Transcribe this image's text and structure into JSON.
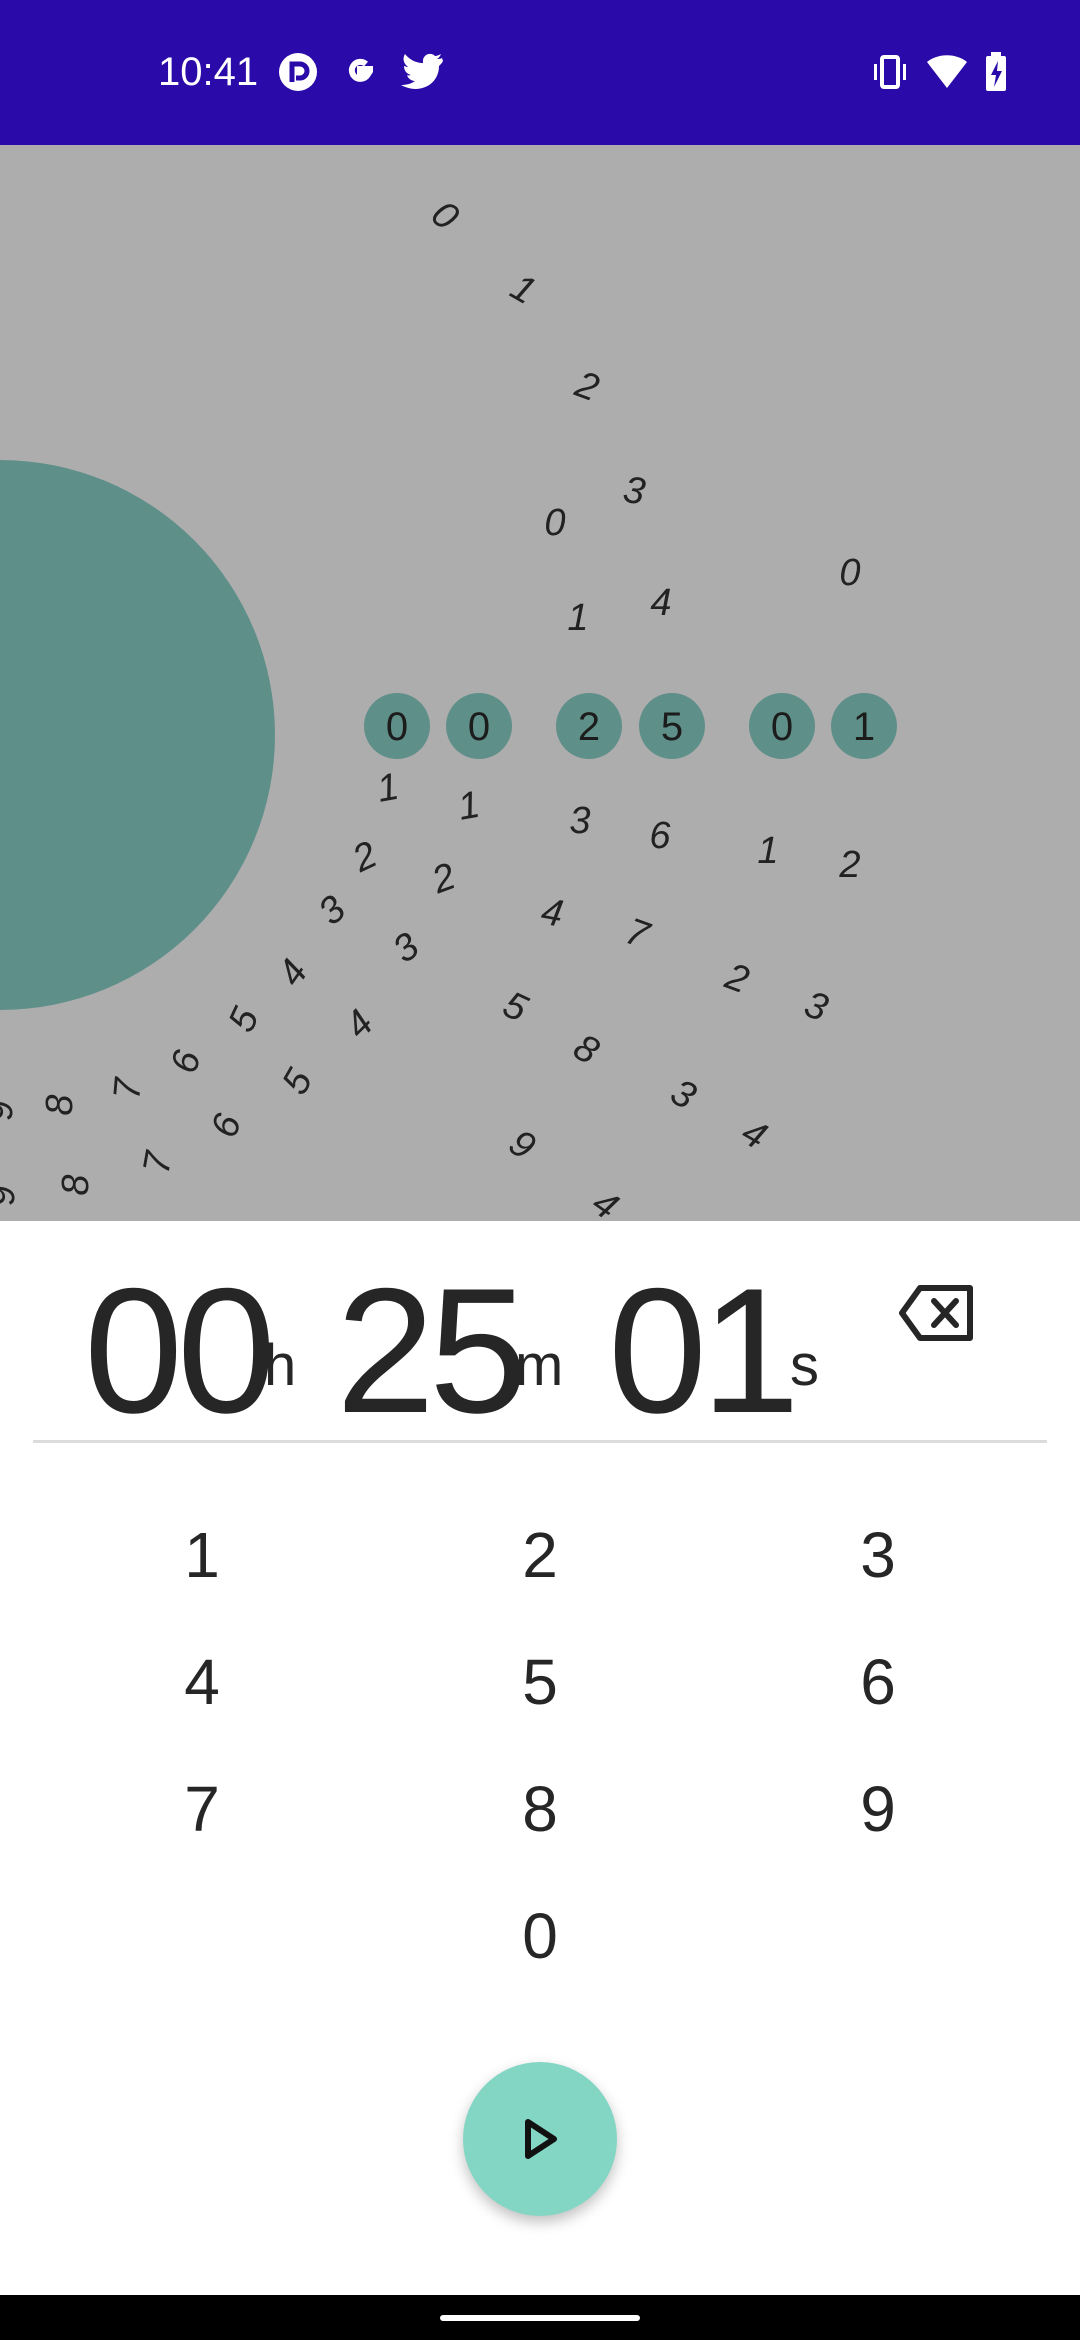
{
  "status_bar": {
    "time": "10:41",
    "notification_icons": [
      "pocket-casts-icon",
      "google-icon",
      "twitter-icon"
    ],
    "system_icons": [
      "vibrate-icon",
      "wifi-icon",
      "battery-charging-icon"
    ],
    "background": "#2a0aa8"
  },
  "hero": {
    "background": "#adadad",
    "accent": "#5f8f89",
    "selected_digits": [
      "0",
      "0",
      "2",
      "5",
      "0",
      "1"
    ]
  },
  "timer": {
    "hours": "00",
    "hours_unit": "h",
    "minutes": "25",
    "minutes_unit": "m",
    "seconds": "01",
    "seconds_unit": "s",
    "backspace_icon": "backspace-icon"
  },
  "keypad": {
    "keys": [
      "1",
      "2",
      "3",
      "4",
      "5",
      "6",
      "7",
      "8",
      "9",
      "0"
    ]
  },
  "start_button": {
    "icon": "play-icon",
    "color": "#84d6c4"
  }
}
